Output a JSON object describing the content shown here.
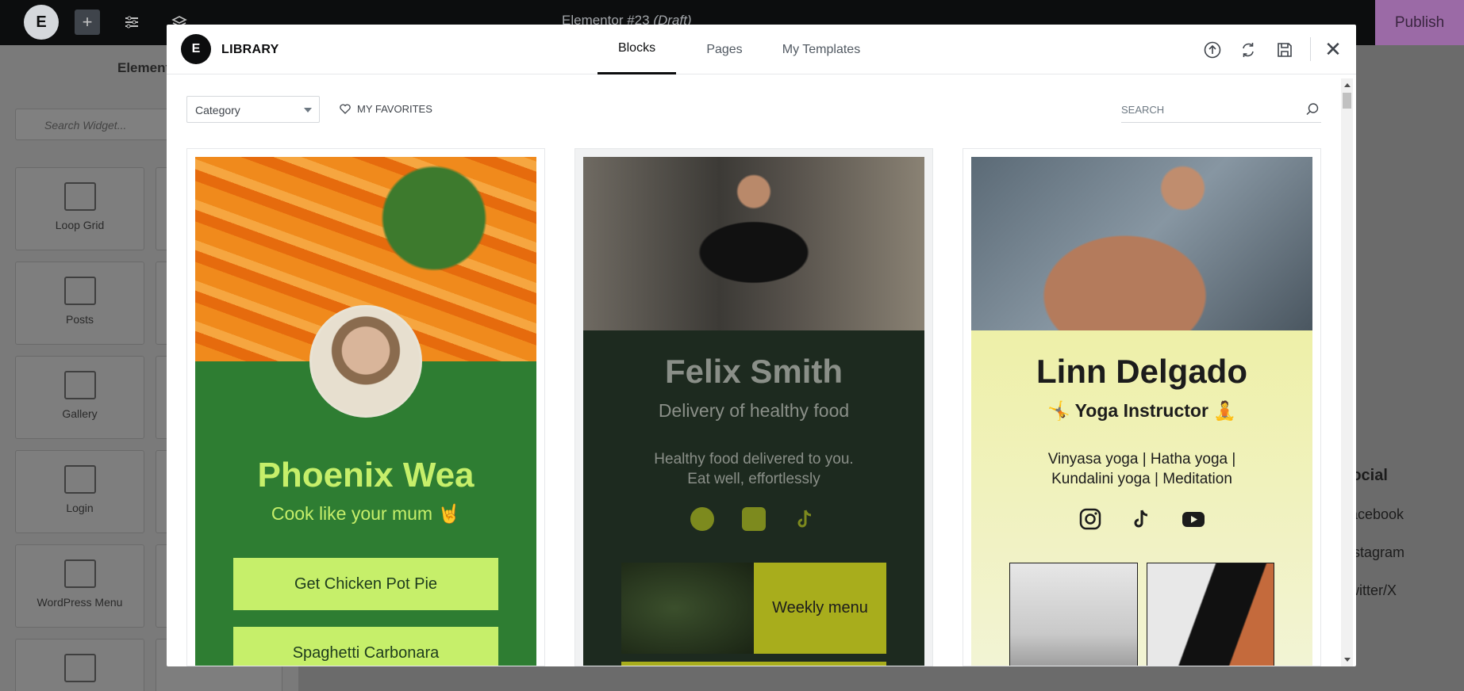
{
  "topbar": {
    "document_title": "Elementor #23",
    "document_status": "(Draft)",
    "publish_label": "Publish"
  },
  "panel": {
    "title": "Elements",
    "search_placeholder": "Search Widget...",
    "widgets": [
      "Loop Grid",
      "Posts",
      "Gallery",
      "Login",
      "WordPress Menu"
    ]
  },
  "background_page": {
    "social_heading": "Social",
    "links": [
      "Facebook",
      "Instagram",
      "Twitter/X"
    ]
  },
  "library": {
    "title": "LIBRARY",
    "tabs": [
      {
        "label": "Blocks",
        "active": true
      },
      {
        "label": "Pages",
        "active": false
      },
      {
        "label": "My Templates",
        "active": false
      }
    ],
    "toolbar": {
      "category_value": "Category",
      "favorites_label": "MY FAVORITES",
      "search_placeholder": "SEARCH"
    },
    "templates": [
      {
        "name": "Phoenix Wea",
        "tagline": "Cook like your mum 🤘",
        "buttons": [
          "Get Chicken Pot Pie",
          "Spaghetti Carbonara"
        ]
      },
      {
        "name": "Felix Smith",
        "tagline": "Delivery of healthy food",
        "desc_line1": "Healthy food delivered to you.",
        "desc_line2": "Eat well, effortlessly",
        "menu_label": "Weekly menu"
      },
      {
        "name": "Linn Delgado",
        "tagline": "🤸 Yoga Instructor 🧘",
        "desc_line1": "Vinyasa yoga | Hatha yoga |",
        "desc_line2": "Kundalini yoga | Meditation"
      }
    ]
  }
}
